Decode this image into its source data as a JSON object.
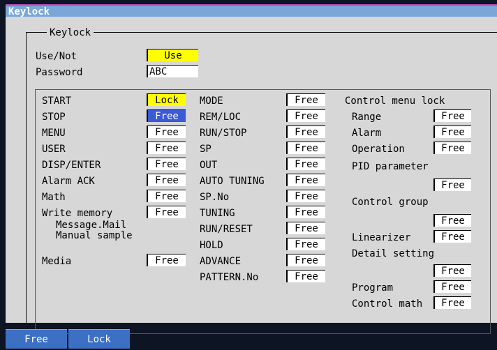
{
  "title": "Keylock",
  "section_title": "Keylock",
  "use_not": {
    "label": "Use/Not",
    "value": "Use"
  },
  "password": {
    "label": "Password",
    "value": "ABC"
  },
  "col1": [
    {
      "label": "START",
      "value": "Lock"
    },
    {
      "label": "STOP",
      "value": "Free"
    },
    {
      "label": "MENU",
      "value": "Free"
    },
    {
      "label": "USER",
      "value": "Free"
    },
    {
      "label": "DISP/ENTER",
      "value": "Free"
    },
    {
      "label": "Alarm ACK",
      "value": "Free"
    },
    {
      "label": "Math",
      "value": "Free"
    },
    {
      "label": "Write memory",
      "value": "Free"
    }
  ],
  "col1_note_1": "Message.Mail",
  "col1_note_2": "Manual sample",
  "media": {
    "label": "Media",
    "value": "Free"
  },
  "col2": [
    {
      "label": "MODE",
      "value": "Free"
    },
    {
      "label": "REM/LOC",
      "value": "Free"
    },
    {
      "label": "RUN/STOP",
      "value": "Free"
    },
    {
      "label": "SP",
      "value": "Free"
    },
    {
      "label": "OUT",
      "value": "Free"
    },
    {
      "label": "AUTO TUNING",
      "value": "Free"
    },
    {
      "label": "SP.No",
      "value": "Free"
    },
    {
      "label": "TUNING",
      "value": "Free"
    },
    {
      "label": "RUN/RESET",
      "value": "Free"
    },
    {
      "label": "HOLD",
      "value": "Free"
    },
    {
      "label": "ADVANCE",
      "value": "Free"
    },
    {
      "label": "PATTERN.No",
      "value": "Free"
    }
  ],
  "col3": {
    "header": "Control menu lock",
    "range": {
      "label": "Range",
      "value": "Free"
    },
    "alarm": {
      "label": "Alarm",
      "value": "Free"
    },
    "operation": {
      "label": "Operation",
      "value": "Free"
    },
    "pid": {
      "label": "PID parameter",
      "value": "Free"
    },
    "control_group": {
      "label": "Control group",
      "value": "Free"
    },
    "linearizer": {
      "label": "Linearizer",
      "value": "Free"
    },
    "detail": {
      "label": "Detail setting",
      "value": "Free"
    },
    "program": {
      "label": "Program",
      "value": "Free"
    },
    "control_math": {
      "label": "Control math",
      "value": "Free"
    }
  },
  "softkeys": {
    "free": "Free",
    "lock": "Lock"
  },
  "colors": {
    "title_bar": "#7aa7d8",
    "panel": "#d7d7d7",
    "highlight": "#ffff00",
    "selected": "#3b5ad6",
    "softkey": "#3b70c4"
  }
}
